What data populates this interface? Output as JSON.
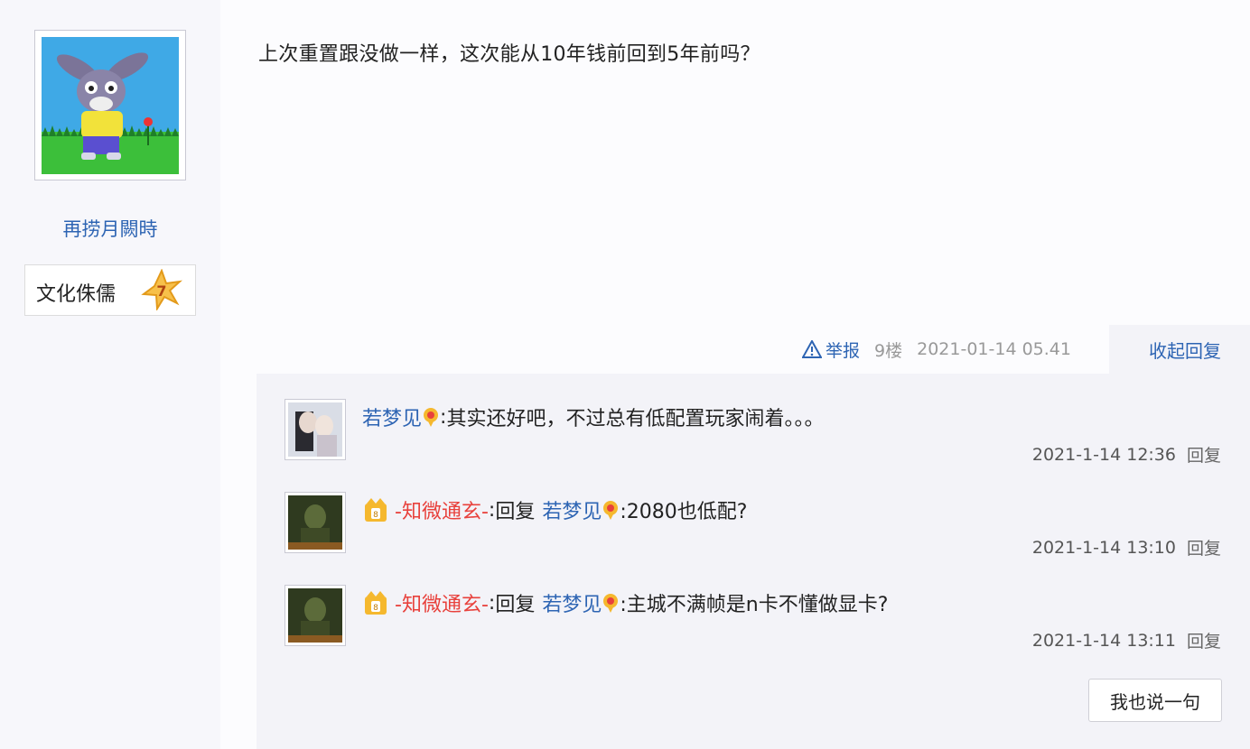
{
  "user": {
    "name": "再捞月闕時",
    "badge_label": "文化侏儒",
    "badge_level": "7",
    "avatar_icon": "cartoon-donkey-avatar"
  },
  "post": {
    "text": "上次重置跟没做一样，这次能从10年钱前回到5年前吗？",
    "report_label": "举报",
    "floor": "9楼",
    "time": "2021-01-14 05.41",
    "collapse_label": "收起回复"
  },
  "replies": [
    {
      "author": "若梦见",
      "sep": ": ",
      "text": "其实还好吧，不过总有低配置玩家闹着。。。",
      "time": "2021-1-14 12:36",
      "reply_label": "回复"
    },
    {
      "author": "-知微通玄-",
      "sep": ": ",
      "reply_word": "回复",
      "reply_to": "若梦见",
      "text": ":2080也低配?",
      "time": "2021-1-14 13:10",
      "reply_label": "回复"
    },
    {
      "author": "-知微通玄-",
      "sep": ": ",
      "reply_word": "回复",
      "reply_to": "若梦见",
      "text": ":主城不满帧是n卡不懂做显卡?",
      "time": "2021-1-14 13:11",
      "reply_label": "回复"
    }
  ],
  "say_button_label": "我也说一句",
  "colors": {
    "link_blue": "#2d64b3",
    "author_red": "#e8413c",
    "panel_bg": "#f3f3f8"
  }
}
